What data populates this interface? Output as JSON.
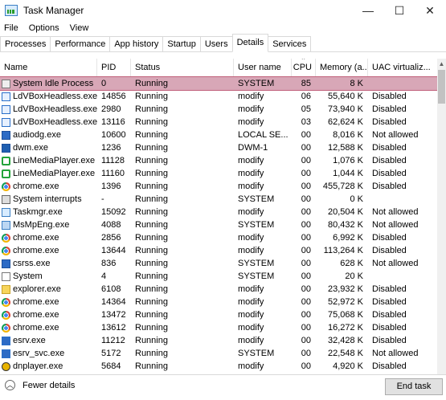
{
  "window": {
    "title": "Task Manager",
    "controls": {
      "minimize": "—",
      "maximize": "☐",
      "close": "✕"
    }
  },
  "menu": [
    "File",
    "Options",
    "View"
  ],
  "tabs": [
    "Processes",
    "Performance",
    "App history",
    "Startup",
    "Users",
    "Details",
    "Services"
  ],
  "active_tab": "Details",
  "columns": {
    "name": "Name",
    "pid": "PID",
    "status": "Status",
    "user": "User name",
    "cpu": "CPU",
    "memory": "Memory (a...",
    "uac": "UAC virtualiz..."
  },
  "sort_arrow": "^",
  "rows": [
    {
      "name": "System Idle Process",
      "pid": "0",
      "status": "Running",
      "user": "SYSTEM",
      "cpu": "85",
      "mem": "8 K",
      "uac": "",
      "icon": "system-idle-icon",
      "cls": "ic-sysidle",
      "selected": true
    },
    {
      "name": "LdVBoxHeadless.exe",
      "pid": "14856",
      "status": "Running",
      "user": "modify",
      "cpu": "06",
      "mem": "55,640 K",
      "uac": "Disabled",
      "icon": "ldvbox-icon",
      "cls": "ic-ldv"
    },
    {
      "name": "LdVBoxHeadless.exe",
      "pid": "2980",
      "status": "Running",
      "user": "modify",
      "cpu": "05",
      "mem": "73,940 K",
      "uac": "Disabled",
      "icon": "ldvbox-icon",
      "cls": "ic-ldv"
    },
    {
      "name": "LdVBoxHeadless.exe",
      "pid": "13116",
      "status": "Running",
      "user": "modify",
      "cpu": "03",
      "mem": "62,624 K",
      "uac": "Disabled",
      "icon": "ldvbox-icon",
      "cls": "ic-ldv"
    },
    {
      "name": "audiodg.exe",
      "pid": "10600",
      "status": "Running",
      "user": "LOCAL SE...",
      "cpu": "00",
      "mem": "8,016 K",
      "uac": "Not allowed",
      "icon": "audiodg-icon",
      "cls": "ic-audio"
    },
    {
      "name": "dwm.exe",
      "pid": "1236",
      "status": "Running",
      "user": "DWM-1",
      "cpu": "00",
      "mem": "12,588 K",
      "uac": "Disabled",
      "icon": "dwm-icon",
      "cls": "ic-dwm"
    },
    {
      "name": "LineMediaPlayer.exe",
      "pid": "11128",
      "status": "Running",
      "user": "modify",
      "cpu": "00",
      "mem": "1,076 K",
      "uac": "Disabled",
      "icon": "line-icon",
      "cls": "ic-line"
    },
    {
      "name": "LineMediaPlayer.exe",
      "pid": "11160",
      "status": "Running",
      "user": "modify",
      "cpu": "00",
      "mem": "1,044 K",
      "uac": "Disabled",
      "icon": "line-icon",
      "cls": "ic-line"
    },
    {
      "name": "chrome.exe",
      "pid": "1396",
      "status": "Running",
      "user": "modify",
      "cpu": "00",
      "mem": "455,728 K",
      "uac": "Disabled",
      "icon": "chrome-icon",
      "cls": "ic-chrome-dot"
    },
    {
      "name": "System interrupts",
      "pid": "-",
      "status": "Running",
      "user": "SYSTEM",
      "cpu": "00",
      "mem": "0 K",
      "uac": "",
      "icon": "system-interrupts-icon",
      "cls": "ic-sysint"
    },
    {
      "name": "Taskmgr.exe",
      "pid": "15092",
      "status": "Running",
      "user": "modify",
      "cpu": "00",
      "mem": "20,504 K",
      "uac": "Not allowed",
      "icon": "taskmgr-icon",
      "cls": "ic-taskmgr"
    },
    {
      "name": "MsMpEng.exe",
      "pid": "4088",
      "status": "Running",
      "user": "SYSTEM",
      "cpu": "00",
      "mem": "80,432 K",
      "uac": "Not allowed",
      "icon": "msmpeng-icon",
      "cls": "ic-msmp"
    },
    {
      "name": "chrome.exe",
      "pid": "2856",
      "status": "Running",
      "user": "modify",
      "cpu": "00",
      "mem": "6,992 K",
      "uac": "Disabled",
      "icon": "chrome-icon",
      "cls": "ic-chrome-dot"
    },
    {
      "name": "chrome.exe",
      "pid": "13644",
      "status": "Running",
      "user": "modify",
      "cpu": "00",
      "mem": "113,264 K",
      "uac": "Disabled",
      "icon": "chrome-icon",
      "cls": "ic-chrome-dot"
    },
    {
      "name": "csrss.exe",
      "pid": "836",
      "status": "Running",
      "user": "SYSTEM",
      "cpu": "00",
      "mem": "628 K",
      "uac": "Not allowed",
      "icon": "csrss-icon",
      "cls": "ic-csrss"
    },
    {
      "name": "System",
      "pid": "4",
      "status": "Running",
      "user": "SYSTEM",
      "cpu": "00",
      "mem": "20 K",
      "uac": "",
      "icon": "system-icon",
      "cls": "ic-system"
    },
    {
      "name": "explorer.exe",
      "pid": "6108",
      "status": "Running",
      "user": "modify",
      "cpu": "00",
      "mem": "23,932 K",
      "uac": "Disabled",
      "icon": "explorer-icon",
      "cls": "ic-explorer"
    },
    {
      "name": "chrome.exe",
      "pid": "14364",
      "status": "Running",
      "user": "modify",
      "cpu": "00",
      "mem": "52,972 K",
      "uac": "Disabled",
      "icon": "chrome-icon",
      "cls": "ic-chrome-dot"
    },
    {
      "name": "chrome.exe",
      "pid": "13472",
      "status": "Running",
      "user": "modify",
      "cpu": "00",
      "mem": "75,068 K",
      "uac": "Disabled",
      "icon": "chrome-icon",
      "cls": "ic-chrome-dot"
    },
    {
      "name": "chrome.exe",
      "pid": "13612",
      "status": "Running",
      "user": "modify",
      "cpu": "00",
      "mem": "16,272 K",
      "uac": "Disabled",
      "icon": "chrome-icon",
      "cls": "ic-chrome-dot"
    },
    {
      "name": "esrv.exe",
      "pid": "11212",
      "status": "Running",
      "user": "modify",
      "cpu": "00",
      "mem": "32,428 K",
      "uac": "Disabled",
      "icon": "esrv-icon",
      "cls": "ic-esrv"
    },
    {
      "name": "esrv_svc.exe",
      "pid": "5172",
      "status": "Running",
      "user": "SYSTEM",
      "cpu": "00",
      "mem": "22,548 K",
      "uac": "Not allowed",
      "icon": "esrv-svc-icon",
      "cls": "ic-esrv"
    },
    {
      "name": "dnplayer.exe",
      "pid": "5684",
      "status": "Running",
      "user": "modify",
      "cpu": "00",
      "mem": "4,920 K",
      "uac": "Disabled",
      "icon": "dnplayer-icon",
      "cls": "ic-dnp"
    }
  ],
  "footer": {
    "fewer_details": "Fewer details",
    "end_task": "End task"
  }
}
